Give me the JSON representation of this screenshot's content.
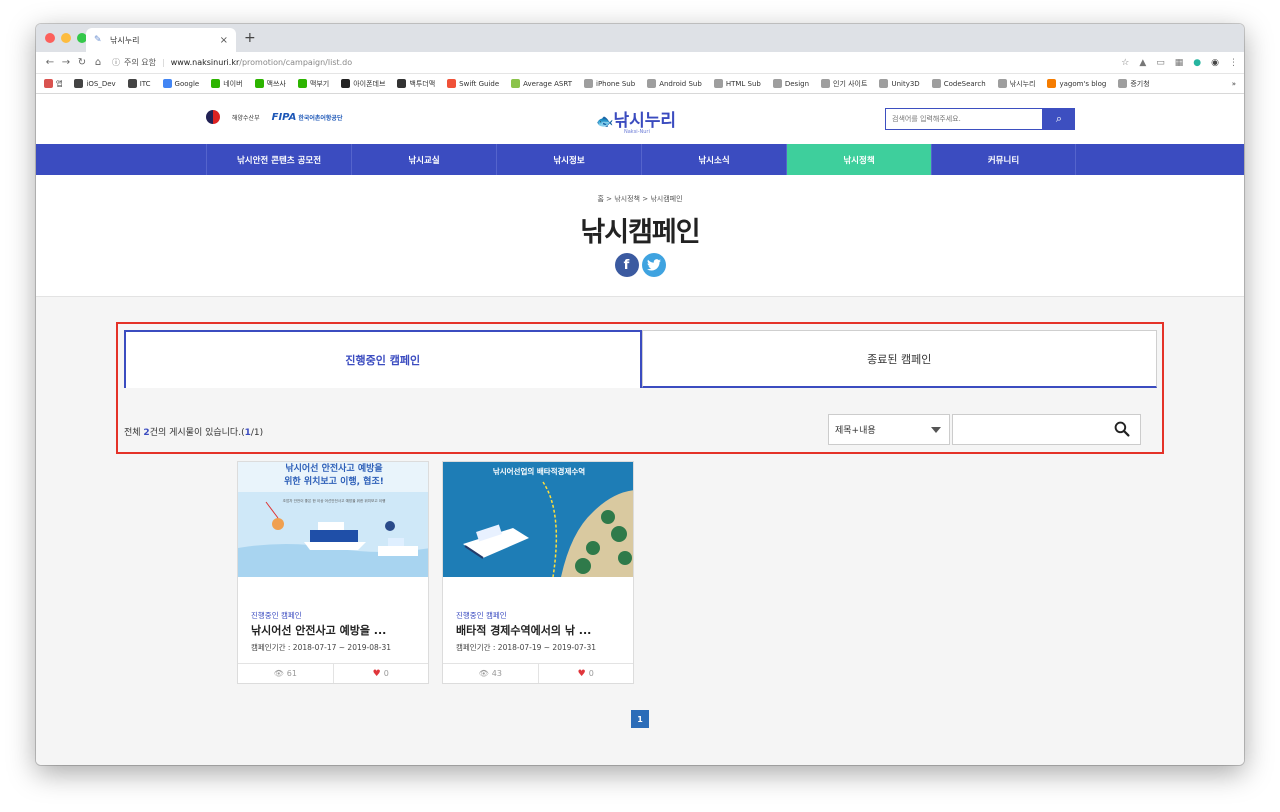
{
  "browser": {
    "tab_title": "낚시누리",
    "tab_close": "×",
    "new_tab": "+",
    "security_label": "주의 요함",
    "url_host": "www.naksinuri.kr",
    "url_path": "/promotion/campaign/list.do",
    "bookmarks_more": "»",
    "bookmarks": [
      {
        "label": "앱",
        "color": "#d9534f"
      },
      {
        "label": "iOS_Dev",
        "color": "#444444"
      },
      {
        "label": "ITC",
        "color": "#444444"
      },
      {
        "label": "Google",
        "color": "#4285f4"
      },
      {
        "label": "네이버",
        "color": "#2db400"
      },
      {
        "label": "맥쓰사",
        "color": "#2db400"
      },
      {
        "label": "맥부기",
        "color": "#2db400"
      },
      {
        "label": "아이폰데브",
        "color": "#222222"
      },
      {
        "label": "백투더맥",
        "color": "#333333"
      },
      {
        "label": "Swift Guide",
        "color": "#f05138"
      },
      {
        "label": "Average ASRT",
        "color": "#8bc34a"
      },
      {
        "label": "iPhone Sub",
        "color": "#9e9e9e"
      },
      {
        "label": "Android Sub",
        "color": "#9e9e9e"
      },
      {
        "label": "HTML Sub",
        "color": "#9e9e9e"
      },
      {
        "label": "Design",
        "color": "#9e9e9e"
      },
      {
        "label": "인기 사이트",
        "color": "#9e9e9e"
      },
      {
        "label": "Unity3D",
        "color": "#9e9e9e"
      },
      {
        "label": "CodeSearch",
        "color": "#9e9e9e"
      },
      {
        "label": "낚시누리",
        "color": "#9e9e9e"
      },
      {
        "label": "yagom's blog",
        "color": "#f57c00"
      },
      {
        "label": "증기청",
        "color": "#9e9e9e"
      }
    ]
  },
  "header": {
    "gov_label": "해양수산부",
    "fipa_label": "FIPA",
    "fipa_sub": "한국어촌어항공단",
    "logo_text": "낚시누리",
    "logo_sub": "Naksi-Nuri",
    "search_placeholder": "검색어를 입력해주세요."
  },
  "gnb": [
    {
      "label": "낚시안전 콘텐츠 공모전",
      "active": false
    },
    {
      "label": "낚시교실",
      "active": false
    },
    {
      "label": "낚시정보",
      "active": false
    },
    {
      "label": "낚시소식",
      "active": false
    },
    {
      "label": "낚시정책",
      "active": true
    },
    {
      "label": "커뮤니티",
      "active": false
    }
  ],
  "title_area": {
    "breadcrumb": "홈 > 낚시정책 > 낚시캠페인",
    "title": "낚시캠페인",
    "facebook": "f",
    "twitter": "t"
  },
  "campaign_tabs": {
    "ongoing": "진행중인 캠페인",
    "ended": "종료된 캠페인"
  },
  "list_info": {
    "prefix": "전체 ",
    "count": "2",
    "suffix": "건의 게시물이 있습니다.(",
    "page": "1",
    "slash": "/",
    "total_pages": "1",
    "close": ")"
  },
  "search": {
    "select_value": "제목+내용",
    "input_value": ""
  },
  "cards": [
    {
      "thumb_line1": "낚시어선 안전사고 예방을",
      "thumb_line2": "위한 위치보고 이행, 협조!",
      "thumb_small": "조업자 안전이 좋은 한 이상 어선안전사고 예방을 위한 위치보고 이행",
      "category": "진행중인 캠페인",
      "title": "낚시어선 안전사고 예방을 ...",
      "period": "캠페인기간 : 2018-07-17 ~ 2019-08-31",
      "views": "61",
      "likes": "0"
    },
    {
      "thumb_line1": "낚시어선업의 배타적경제수역",
      "category": "진행중인 캠페인",
      "title": "배타적 경제수역에서의 낚 ...",
      "period": "캠페인기간 : 2018-07-19 ~ 2019-07-31",
      "views": "43",
      "likes": "0"
    }
  ],
  "pagination": {
    "current": "1"
  },
  "colors": {
    "brand_blue": "#3b4cc0",
    "active_green": "#3ecf9c",
    "highlight_red": "#e43228"
  }
}
